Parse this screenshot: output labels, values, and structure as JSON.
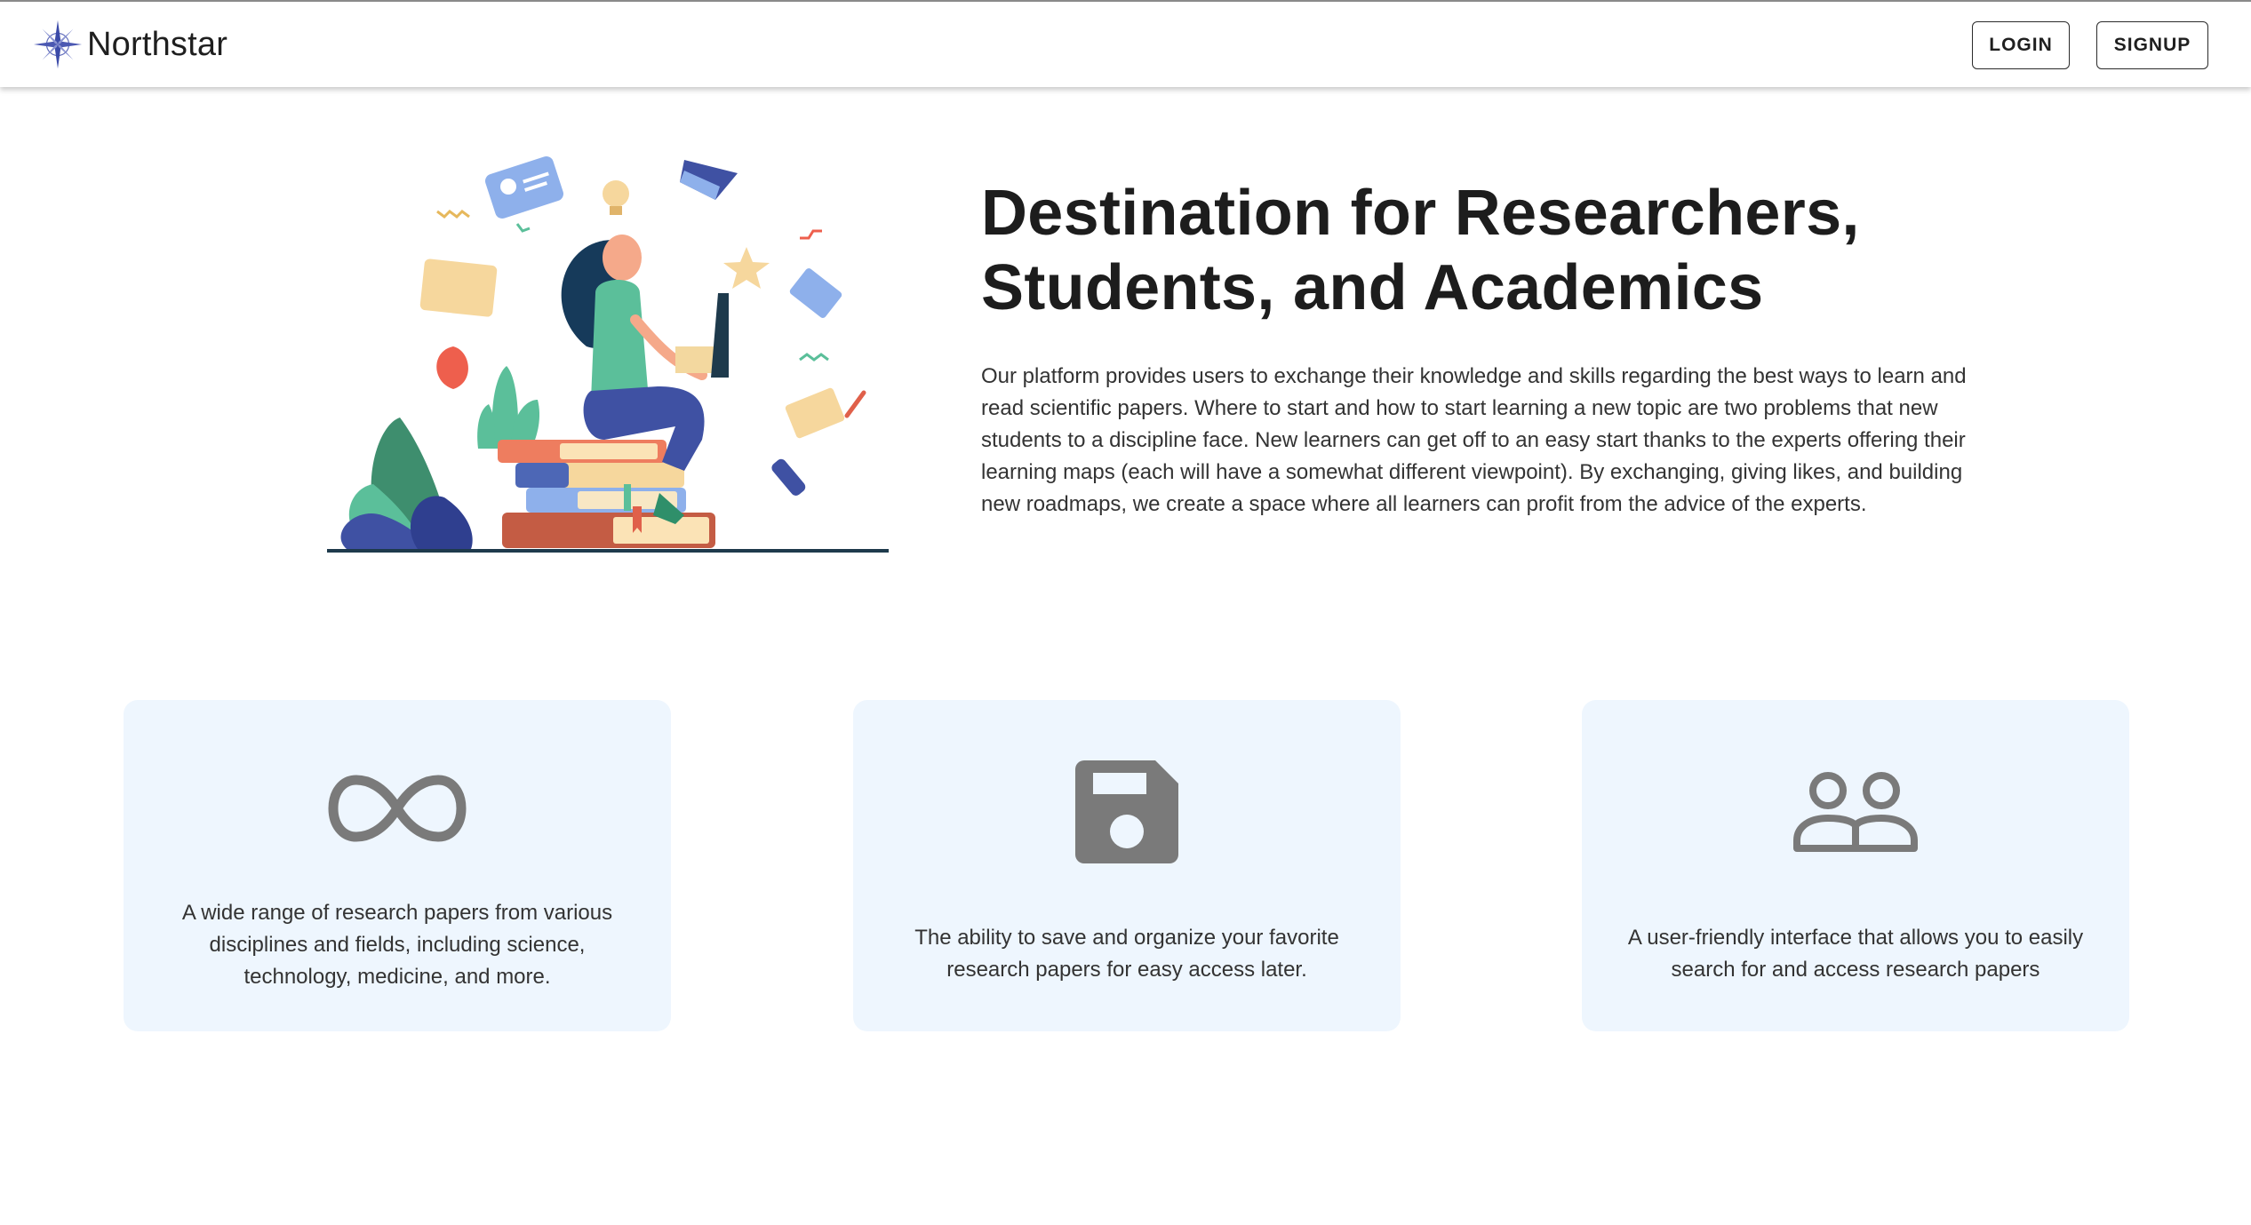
{
  "brand": {
    "name": "Northstar",
    "logo_icon": "compass-star-icon"
  },
  "nav": {
    "login_label": "LOGIN",
    "signup_label": "SIGNUP"
  },
  "hero": {
    "title": "Destination for Researchers, Students, and Academics",
    "description": "Our platform provides users to exchange their knowledge and skills regarding the best ways to learn and read scientific papers. Where to start and how to start learning a new topic are two problems that new students to a discipline face. New learners can get off to an easy start thanks to the experts offering their learning maps (each will have a somewhat different viewpoint). By exchanging, giving likes, and building new roadmaps, we create a space where all learners can profit from the advice of the experts.",
    "illustration": "woman-studying-on-books-illustration"
  },
  "features": [
    {
      "icon": "infinity-icon",
      "text": "A wide range of research papers from various disciplines and fields, including science, technology, medicine, and more."
    },
    {
      "icon": "save-floppy-icon",
      "text": "The ability to save and organize your favorite research papers for easy access later."
    },
    {
      "icon": "people-group-icon",
      "text": "A user-friendly interface that allows you to easily search for and access research papers"
    }
  ],
  "colors": {
    "card_background": "#eef6fe",
    "icon_gray": "#7a7a7a",
    "logo_blue": "#3b4aa8"
  }
}
